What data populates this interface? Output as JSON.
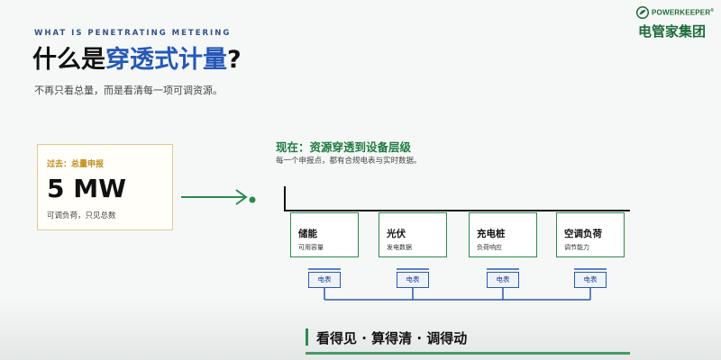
{
  "header": {
    "eyebrow": "WHAT IS PENETRATING METERING",
    "title_part1": "什么是",
    "title_highlight": "穿透式计量",
    "title_part2": "?",
    "subtitle": "不再只看总量，而是看清每一项可调资源。"
  },
  "logo": {
    "brand_en": "POWERKEEPER",
    "registered_mark": "®",
    "brand_cn": "电管家集团",
    "icon": "leaf-swirl-icon"
  },
  "past": {
    "label": "过去：总量申报",
    "value": "5 MW",
    "note": "可调负荷，只见总数"
  },
  "now": {
    "title": "现在：资源穿透到设备层级",
    "subtitle": "每一个申报点，都有合规电表与实时数据。"
  },
  "devices": [
    {
      "name": "储能",
      "desc": "可用容量"
    },
    {
      "name": "光伏",
      "desc": "发电数据"
    },
    {
      "name": "充电桩",
      "desc": "负荷响应"
    },
    {
      "name": "空调负荷",
      "desc": "调节能力"
    }
  ],
  "meter_label": "电表",
  "slogan": "看得见 · 算得清 · 调得动",
  "colors": {
    "accent_green": "#2c8a4d",
    "accent_blue": "#2558b8",
    "past_gold": "#c48a1a"
  }
}
